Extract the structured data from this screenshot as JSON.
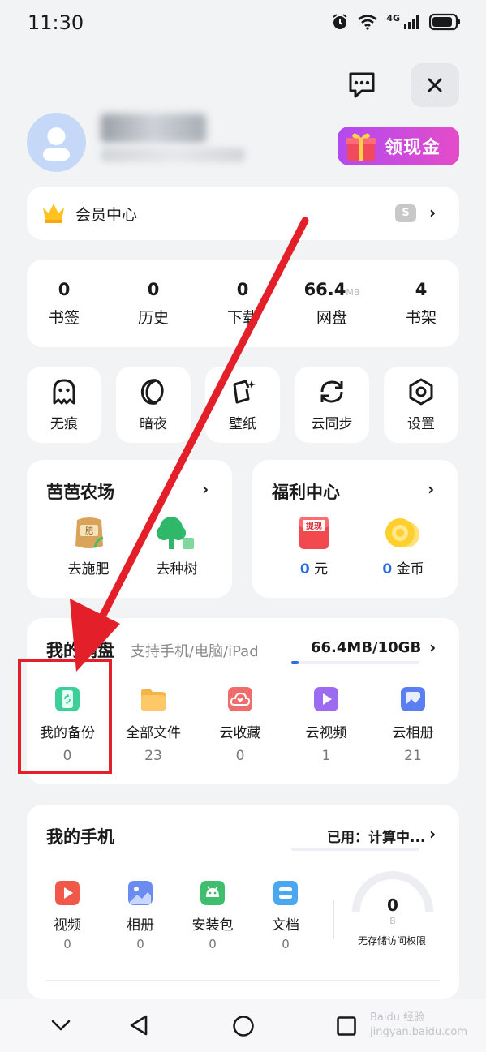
{
  "status": {
    "time": "11:30",
    "network": "4G"
  },
  "profile": {
    "cash_button": "领现金"
  },
  "member": {
    "label": "会员中心",
    "badge_letter": "S"
  },
  "stats": [
    {
      "value": "0",
      "unit": "",
      "label": "书签"
    },
    {
      "value": "0",
      "unit": "",
      "label": "历史"
    },
    {
      "value": "0",
      "unit": "",
      "label": "下载"
    },
    {
      "value": "66.4",
      "unit": "MB",
      "label": "网盘"
    },
    {
      "value": "4",
      "unit": "",
      "label": "书架"
    }
  ],
  "tools": [
    {
      "label": "无痕",
      "icon": "ghost-icon"
    },
    {
      "label": "暗夜",
      "icon": "moon-icon"
    },
    {
      "label": "壁纸",
      "icon": "wallpaper-icon"
    },
    {
      "label": "云同步",
      "icon": "sync-icon"
    },
    {
      "label": "设置",
      "icon": "settings-icon"
    }
  ],
  "farm": {
    "title": "芭芭农场",
    "items": [
      {
        "label": "去施肥",
        "icon_text": "肥"
      },
      {
        "label": "去种树"
      }
    ]
  },
  "welfare": {
    "title": "福利中心",
    "items": [
      {
        "icon_text": "提现",
        "value": "0",
        "unit": "元"
      },
      {
        "value": "0",
        "unit": "金币"
      }
    ]
  },
  "cloud": {
    "title": "我的网盘",
    "subtitle": "支持手机/电脑/iPad",
    "usage": "66.4MB/10GB",
    "progress_fraction": 0.0065,
    "items": [
      {
        "label": "我的备份",
        "count": "0",
        "color": "#3ccf9a"
      },
      {
        "label": "全部文件",
        "count": "23",
        "color": "#f5b44a"
      },
      {
        "label": "云收藏",
        "count": "0",
        "color": "#f06b6b"
      },
      {
        "label": "云视频",
        "count": "1",
        "color": "#9b6cf0"
      },
      {
        "label": "云相册",
        "count": "21",
        "color": "#5b7ef0"
      }
    ]
  },
  "phone": {
    "title": "我的手机",
    "used": "已用：计算中...",
    "items": [
      {
        "label": "视频",
        "count": "0",
        "color": "#f0584a"
      },
      {
        "label": "相册",
        "count": "0",
        "color": "#6a8bf0"
      },
      {
        "label": "安装包",
        "count": "0",
        "color": "#3fbf6e"
      },
      {
        "label": "文档",
        "count": "0",
        "color": "#4aa8f0"
      }
    ],
    "gauge_value": "0",
    "gauge_unit": "B",
    "no_access": "无存储访问权限"
  },
  "watermark": "Baidu 经验 jingyan.baidu.com"
}
